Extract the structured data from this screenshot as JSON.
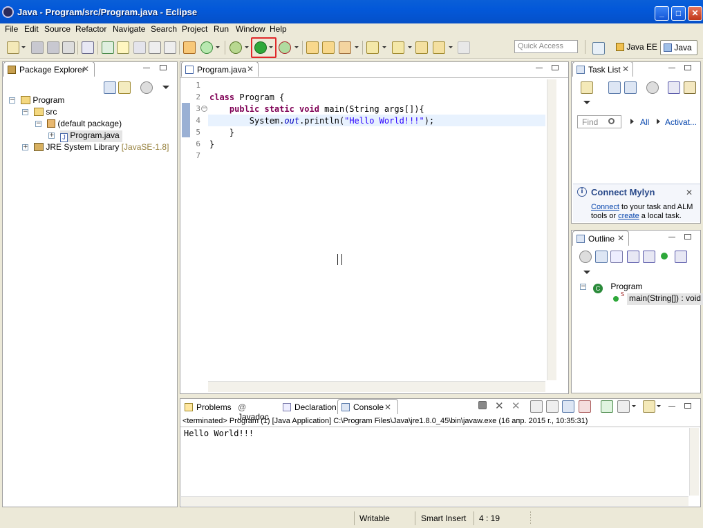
{
  "window": {
    "title": "Java - Program/src/Program.java - Eclipse",
    "min": "_",
    "max": "□",
    "close": "✕"
  },
  "menu": [
    "File",
    "Edit",
    "Source",
    "Refactor",
    "Navigate",
    "Search",
    "Project",
    "Run",
    "Window",
    "Help"
  ],
  "toolbar": {
    "quick_access_placeholder": "Quick Access",
    "highlight_color": "#e0282a"
  },
  "perspectives": [
    {
      "label": "Java EE"
    },
    {
      "label": "Java",
      "active": true
    }
  ],
  "package_explorer": {
    "title": "Package Explorer",
    "tree": [
      {
        "label": "Program",
        "icon": "project-icon"
      },
      {
        "label": "src",
        "icon": "source-folder-icon"
      },
      {
        "label": "(default package)",
        "icon": "package-icon"
      },
      {
        "label": "Program.java",
        "icon": "java-file-icon",
        "selected": true
      },
      {
        "label": "JRE System Library",
        "suffix": "[JavaSE-1.8]",
        "icon": "library-icon"
      }
    ]
  },
  "editor": {
    "tab": "Program.java",
    "line_numbers": [
      "1",
      "2",
      "3",
      "4",
      "5",
      "6",
      "7"
    ],
    "lines": [
      [],
      [
        {
          "t": "class",
          "c": "kw"
        },
        {
          "t": " Program {",
          "c": ""
        }
      ],
      [
        {
          "t": "    ",
          "c": ""
        },
        {
          "t": "public static void",
          "c": "kw"
        },
        {
          "t": " main(String args[]){",
          "c": ""
        }
      ],
      [
        {
          "t": "        System.",
          "c": ""
        },
        {
          "t": "out",
          "c": "fld"
        },
        {
          "t": ".println(",
          "c": ""
        },
        {
          "t": "\"Hello World!!!\"",
          "c": "str"
        },
        {
          "t": ");",
          "c": ""
        }
      ],
      [
        {
          "t": "    }",
          "c": ""
        }
      ],
      [
        {
          "t": "}",
          "c": ""
        }
      ],
      []
    ]
  },
  "task_list": {
    "title": "Task List",
    "find_placeholder": "Find",
    "filter_all": "All",
    "filter_activate": "Activat..."
  },
  "mylyn": {
    "title": "Connect Mylyn",
    "link1": "Connect",
    "text1": " to your task and ALM",
    "text2": "tools or ",
    "link2": "create",
    "text3": " a local task."
  },
  "outline": {
    "title": "Outline",
    "class_name": "Program",
    "method": "main(String[]) : void",
    "static_marker": "S"
  },
  "bottom_tabs": [
    {
      "label": "Problems",
      "icon": "problems-icon"
    },
    {
      "label": "Javadoc",
      "icon": "javadoc-icon",
      "glyph": "@"
    },
    {
      "label": "Declaration",
      "icon": "declaration-icon"
    },
    {
      "label": "Console",
      "icon": "console-icon",
      "active": true
    }
  ],
  "console": {
    "header": "<terminated> Program (1) [Java Application] C:\\Program Files\\Java\\jre1.8.0_45\\bin\\javaw.exe (16 апр. 2015 г., 10:35:31)",
    "output": "Hello World!!!"
  },
  "status": {
    "writable": "Writable",
    "insert_mode": "Smart Insert",
    "position": "4 : 19"
  }
}
